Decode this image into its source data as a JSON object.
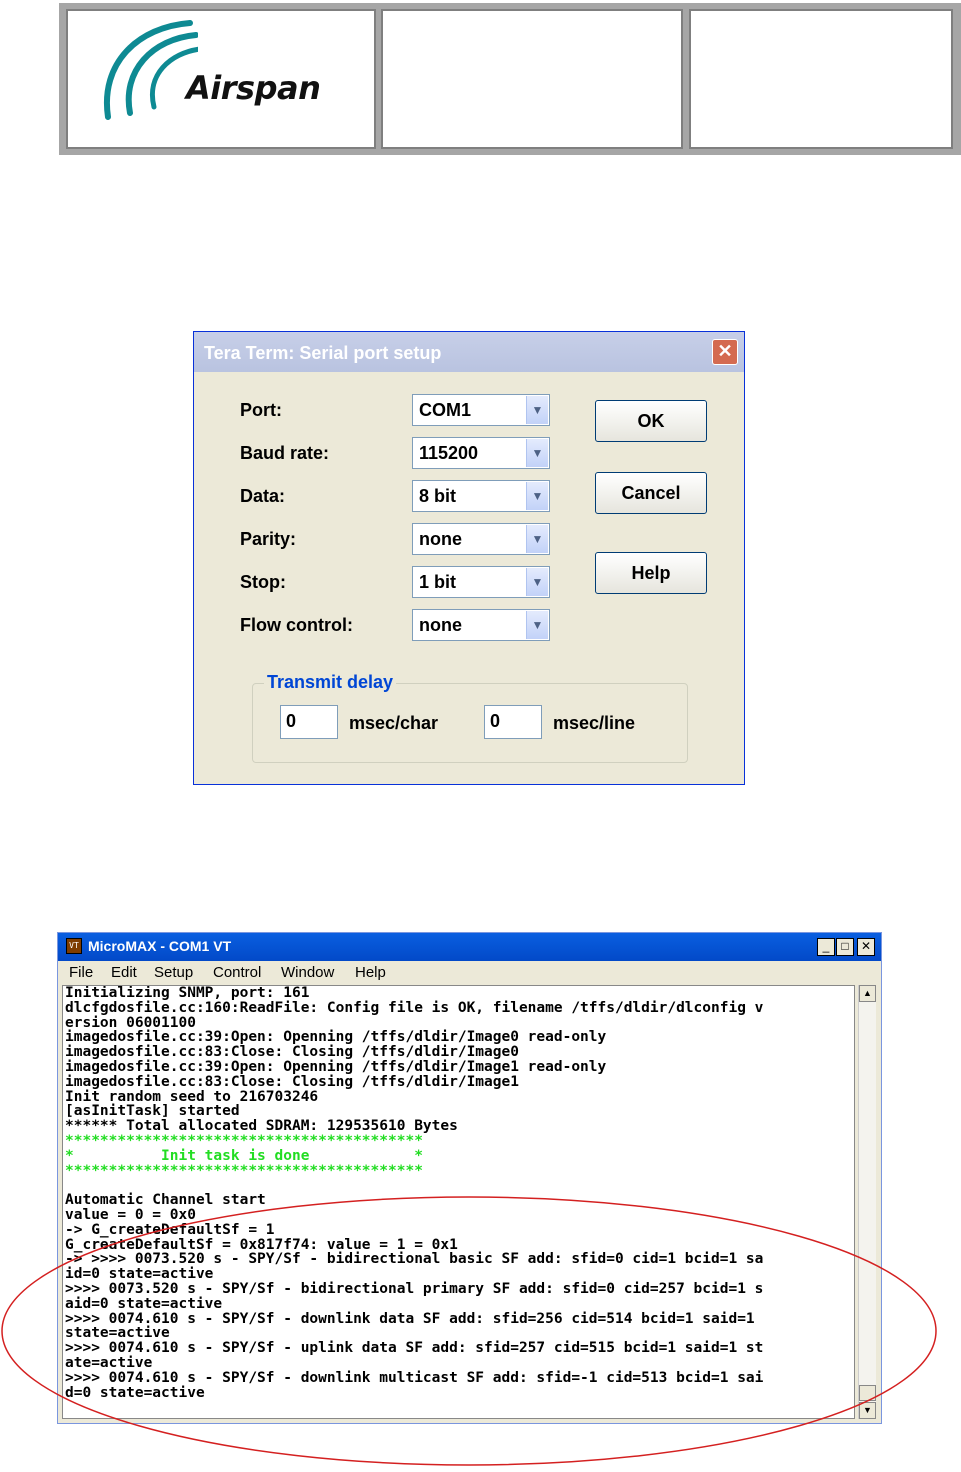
{
  "header": {
    "logo_text": "Airspan"
  },
  "dialog": {
    "title": "Tera Term: Serial port setup",
    "close_glyph": "✕",
    "fields": [
      {
        "label": "Port:",
        "value": "COM1"
      },
      {
        "label": "Baud rate:",
        "value": "115200"
      },
      {
        "label": "Data:",
        "value": "8 bit"
      },
      {
        "label": "Parity:",
        "value": "none"
      },
      {
        "label": "Stop:",
        "value": "1 bit"
      },
      {
        "label": "Flow control:",
        "value": "none"
      }
    ],
    "buttons": {
      "ok": "OK",
      "cancel": "Cancel",
      "help": "Help"
    },
    "transmit_delay": {
      "title": "Transmit delay",
      "char_value": "0",
      "char_unit": "msec/char",
      "line_value": "0",
      "line_unit": "msec/line"
    },
    "colors": {
      "group_title": "#0046d5",
      "face": "#ece9d8"
    }
  },
  "terminal": {
    "title": "MicroMAX - COM1 VT",
    "icon_text": "VT",
    "window_buttons": {
      "minimize": "_",
      "maximize": "□",
      "close": "✕"
    },
    "menu": [
      "File",
      "Edit",
      "Setup",
      "Control",
      "Window",
      "Help"
    ],
    "lines": [
      "Initializing SNMP, port: 161",
      "dlcfgdosfile.cc:160:ReadFile: Config file is OK, filename /tffs/dldir/dlconfig v",
      "ersion 06001100",
      "imagedosfile.cc:39:Open: Openning /tffs/dldir/Image0 read-only",
      "imagedosfile.cc:83:Close: Closing /tffs/dldir/Image0",
      "imagedosfile.cc:39:Open: Openning /tffs/dldir/Image1 read-only",
      "imagedosfile.cc:83:Close: Closing /tffs/dldir/Image1",
      "Init random seed to 216703246",
      "[asInitTask] started",
      "****** Total allocated SDRAM: 129535610 Bytes",
      "*****************************************",
      "*          Init task is done            *",
      "*****************************************",
      "",
      "Automatic Channel start",
      "value = 0 = 0x0",
      "-> G_createDefaultSf = 1",
      "G_createDefaultSf = 0x817f74: value = 1 = 0x1",
      "-> >>>> 0073.520 s - SPY/Sf - bidirectional basic SF add: sfid=0 cid=1 bcid=1 sa",
      "id=0 state=active",
      ">>>> 0073.520 s - SPY/Sf - bidirectional primary SF add: sfid=0 cid=257 bcid=1 s",
      "aid=0 state=active",
      ">>>> 0074.610 s - SPY/Sf - downlink data SF add: sfid=256 cid=514 bcid=1 said=1",
      "state=active",
      ">>>> 0074.610 s - SPY/Sf - uplink data SF add: sfid=257 cid=515 bcid=1 said=1 st",
      "ate=active",
      ">>>> 0074.610 s - SPY/Sf - downlink multicast SF add: sfid=-1 cid=513 bcid=1 sai",
      "d=0 state=active"
    ],
    "green_lines": [
      10,
      11,
      12
    ],
    "colors": {
      "titlebar": "#0a5fe0",
      "highlight_text": "#22dd22",
      "annotation_ellipse": "#d42020"
    }
  }
}
